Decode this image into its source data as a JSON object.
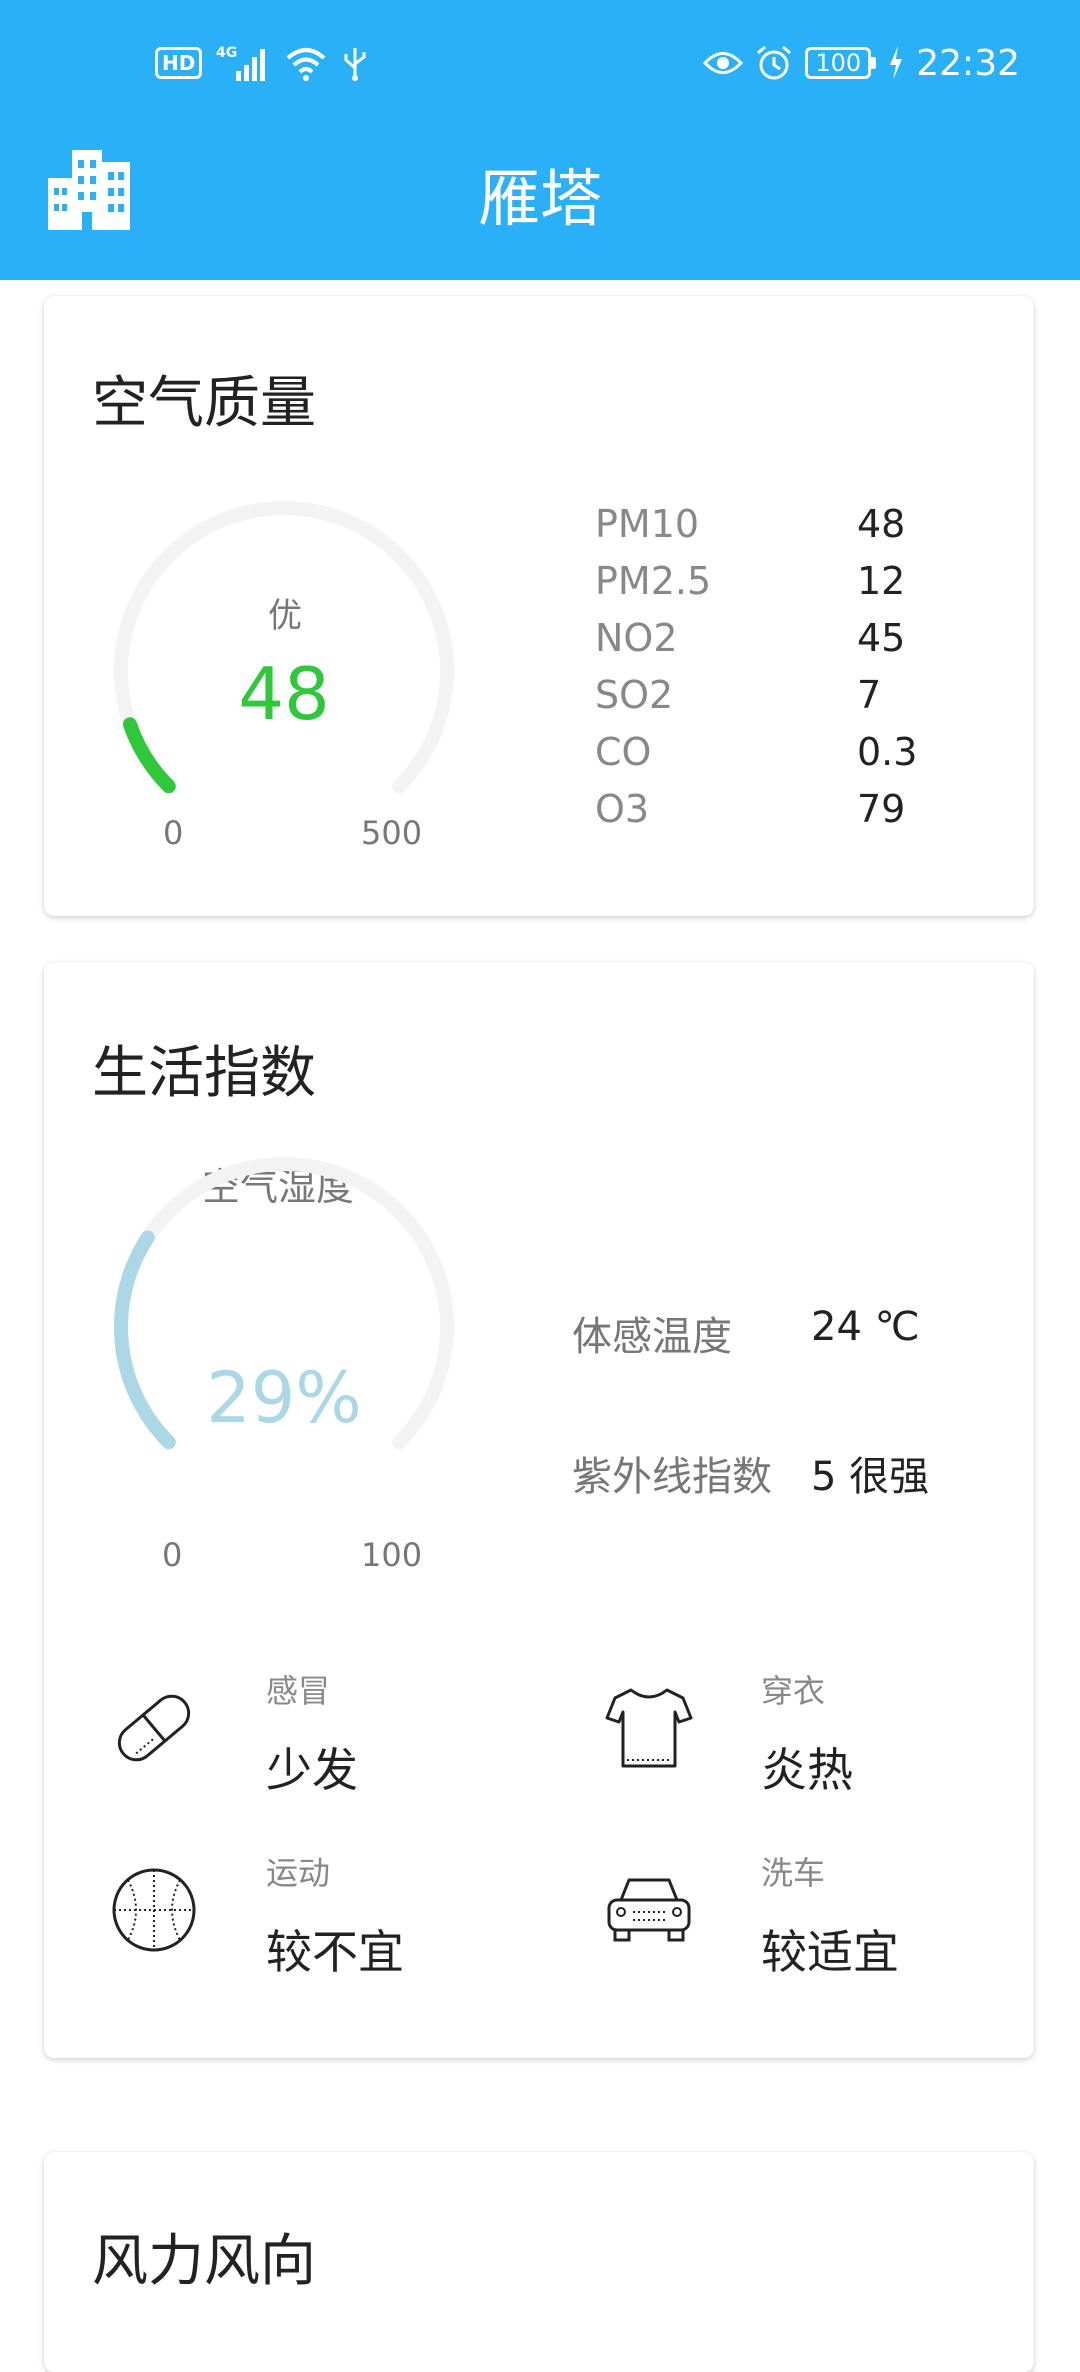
{
  "status_bar": {
    "left_icons": [
      "hd-icon",
      "4g-signal-icon",
      "wifi-icon",
      "usb-icon"
    ],
    "hd_text": "HD",
    "network_text": "4G",
    "right_icons": [
      "eye-icon",
      "alarm-icon",
      "battery-icon",
      "charging-icon"
    ],
    "battery": "100",
    "time": "22:32"
  },
  "app_bar": {
    "icon": "city-buildings-icon",
    "title": "雁塔"
  },
  "air_quality": {
    "title": "空气质量",
    "gauge": {
      "label": "优",
      "value": "48",
      "min": "0",
      "max": "500",
      "level": 48,
      "color": "#2ec83a"
    },
    "pollutants": [
      {
        "name": "PM10",
        "value": "48"
      },
      {
        "name": "PM2.5",
        "value": "12"
      },
      {
        "name": "NO2",
        "value": "45"
      },
      {
        "name": "SO2",
        "value": "7"
      },
      {
        "name": "CO",
        "value": "0.3"
      },
      {
        "name": "O3",
        "value": "79"
      }
    ]
  },
  "life_index": {
    "title": "生活指数",
    "humidity": {
      "label": "空气湿度",
      "value": "29%",
      "min": "0",
      "max": "100",
      "level": 29,
      "color": "#acd8e6"
    },
    "feels_like": {
      "label": "体感温度",
      "value": "24 ℃"
    },
    "uv": {
      "label": "紫外线指数",
      "value": "5 很强"
    },
    "items": [
      {
        "icon": "pill-icon",
        "name": "感冒",
        "value": "少发"
      },
      {
        "icon": "tshirt-icon",
        "name": "穿衣",
        "value": "炎热"
      },
      {
        "icon": "basketball-icon",
        "name": "运动",
        "value": "较不宜"
      },
      {
        "icon": "car-icon",
        "name": "洗车",
        "value": "较适宜"
      }
    ]
  },
  "wind": {
    "title": "风力风向"
  },
  "colors": {
    "header": "#29b0f6",
    "track": "#f3f3f3"
  }
}
